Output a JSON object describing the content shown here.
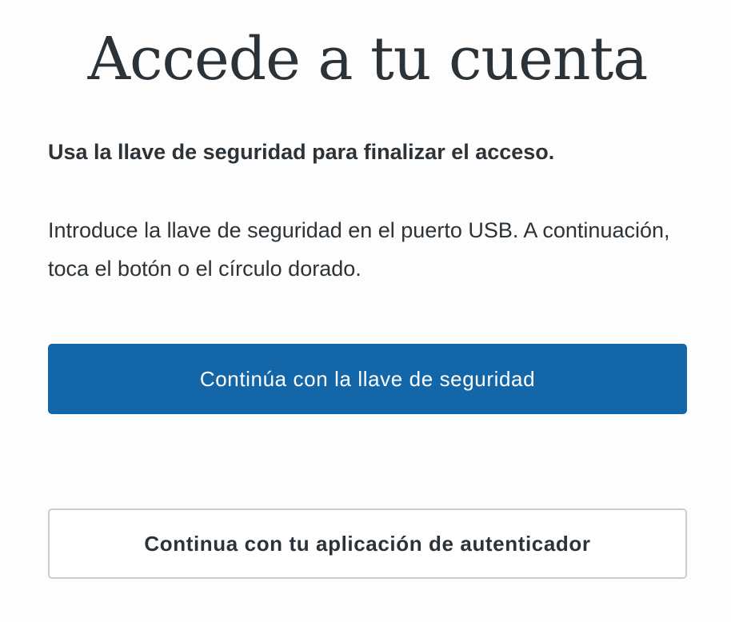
{
  "login": {
    "title": "Accede a tu cuenta",
    "subtitle": "Usa la llave de seguridad para finalizar el acceso.",
    "instructions": "Introduce la llave de seguridad en el puerto USB. A continuación, toca el botón o el círculo dorado.",
    "primary_button_label": "Continúa con la llave de seguridad",
    "secondary_button_label": "Continua con tu aplicación de autenticador"
  },
  "colors": {
    "background": "#fdfdfd",
    "text": "#2c3338",
    "primary": "#1366a8",
    "primary_text": "#ffffff",
    "secondary_border": "#c9cdd1"
  }
}
